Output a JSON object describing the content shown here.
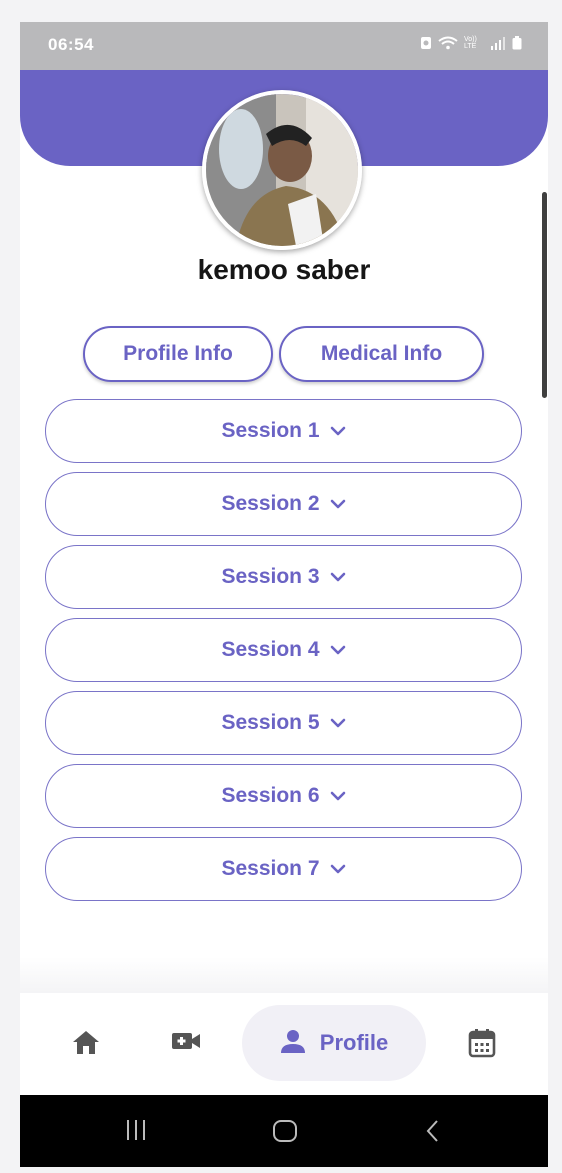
{
  "status_bar": {
    "time": "06:54",
    "carrier": "Vo)) LTE"
  },
  "profile": {
    "name": "kemoo saber",
    "avatar_icon": "user-photo"
  },
  "tabs": {
    "profile_info": "Profile Info",
    "medical_info": "Medical Info"
  },
  "sessions": [
    {
      "label": "Session 1"
    },
    {
      "label": "Session 2"
    },
    {
      "label": "Session 3"
    },
    {
      "label": "Session 4"
    },
    {
      "label": "Session 5"
    },
    {
      "label": "Session 6"
    },
    {
      "label": "Session 7"
    }
  ],
  "bottom_nav": {
    "home_icon": "home-icon",
    "video_icon": "video-call-icon",
    "profile_label": "Profile",
    "calendar_icon": "calendar-icon",
    "active": "profile"
  },
  "colors": {
    "accent": "#6a63c4",
    "status_bar": "#b9b9bb",
    "nav_active_bg": "#f1f0f6"
  }
}
